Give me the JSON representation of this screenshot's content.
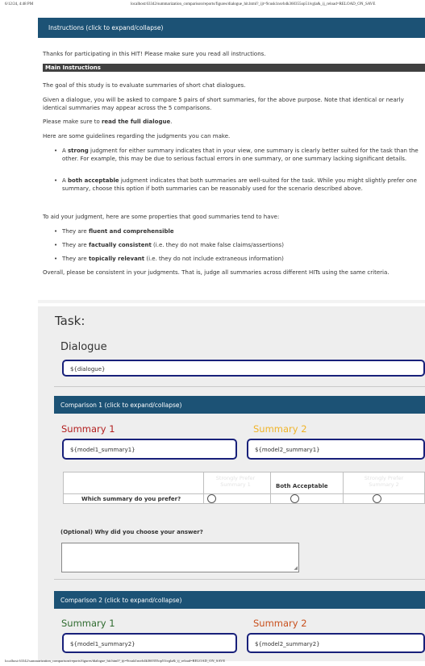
{
  "print_header": {
    "datetime": "6/12/24, 4:48 PM",
    "url": "localhost:63342/summarization_comparison/reports/figures/dialogue_hit.html?_ijt=9cusk1nsvb4k360355op51ivgla&_ij_reload=RELOAD_ON_SAVE"
  },
  "print_footer": {
    "url": "localhost:63342/summarization_comparison/reports/figures/dialogue_hit.html?_ijt=9cusk1nsvb4k360355op51ivgla&_ij_reload=RELOAD_ON_SAVE"
  },
  "instructions": {
    "bar_label": "Instructions (click to expand/collapse)",
    "thanks": "Thanks for participating in this HIT! Please make sure you read all instructions.",
    "main_header": "Main Instructions",
    "goal": "The goal of this study is to evaluate summaries of short chat dialogues.",
    "given": "Given a dialogue, you will be asked to compare 5 pairs of short summaries, for the above purpose. Note that identical or nearly identical summaries may appear across the 5 comparisons.",
    "read_prefix": "Please make sure to ",
    "read_bold": "read the full dialogue",
    "read_suffix": ".",
    "guidelines_intro": "Here are some guidelines regarding the judgments you can make.",
    "guidelines": [
      {
        "prefix": "A ",
        "bold": "strong",
        "rest": " judgment for either summary indicates that in your view, one summary is clearly better suited for the task than the other. For example, this may be due to serious factual errors in one summary, or one summary lacking significant details."
      },
      {
        "prefix": "A ",
        "bold": "both acceptable",
        "rest": " judgment indicates that both summaries are well-suited for the task. While you might slightly prefer one summary, choose this option if both summaries can be reasonably used for the scenario described above."
      }
    ],
    "properties_intro": "To aid your judgment, here are some properties that good summaries tend to have:",
    "properties": [
      {
        "prefix": "They are ",
        "bold": "fluent and comprehensible",
        "rest": ""
      },
      {
        "prefix": "They are ",
        "bold": "factually consistent",
        "rest": " (i.e. they do not make false claims/assertions)"
      },
      {
        "prefix": "They are ",
        "bold": "topically relevant",
        "rest": " (i.e. they do not include extraneous information)"
      }
    ],
    "overall": "Overall, please be consistent in your judgments. That is, judge all summaries across different HITs using the same criteria."
  },
  "task": {
    "title": "Task:",
    "dialogue_title": "Dialogue",
    "dialogue_value": "${dialogue}"
  },
  "comparisons": [
    {
      "bar_label": "Comparison 1 (click to expand/collapse)",
      "summary1_title": "Summary 1",
      "summary2_title": "Summary 2",
      "summary1_value": "${model1_summary1}",
      "summary2_value": "${model2_summary1}",
      "col_left": "Strongly Prefer Summary 1",
      "col_mid": "Both Acceptable",
      "col_right": "Strongly Prefer Summary 2",
      "row_label": "Which summary do you prefer?",
      "question": "(Optional) Why did you choose your answer?"
    },
    {
      "bar_label": "Comparison 2 (click to expand/collapse)",
      "summary1_title": "Summary 1",
      "summary2_title": "Summary 2",
      "summary1_value": "${model1_summary2}",
      "summary2_value": "${model2_summary2}"
    }
  ],
  "colors": {
    "header_bar": "#1c5275",
    "main_header": "#404040",
    "box_border": "#18207a",
    "comp1_summary1": "#b32020",
    "comp1_summary2": "#f0b429",
    "comp2_summary1": "#2f6b2f",
    "comp2_summary2": "#c9501c"
  }
}
